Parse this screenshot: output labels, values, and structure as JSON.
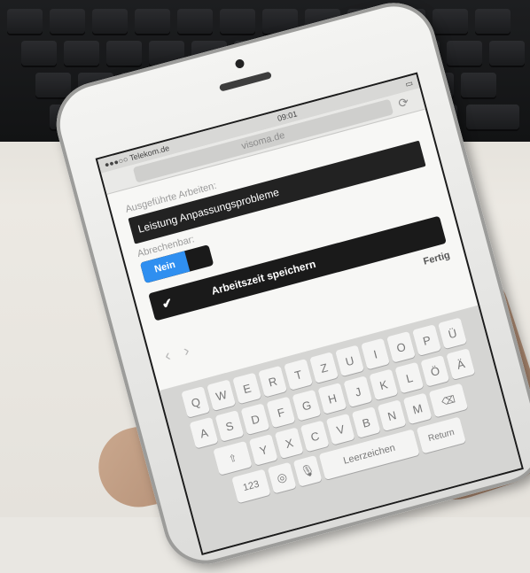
{
  "status": {
    "carrier": "●●●○○ Telekom.de",
    "time": "09:01"
  },
  "browser": {
    "url": "visoma.de",
    "refresh_icon": "refresh-icon"
  },
  "form": {
    "performed_work_label": "Ausgeführte Arbeiten:",
    "performed_work_value": "Leistung Anpassungsprobleme",
    "billable_label": "Abrechenbar:",
    "billable_value": "Nein",
    "save_button_label": "Arbeitszeit speichern",
    "done_label": "Fertig"
  },
  "keyboard": {
    "row1": [
      "Q",
      "W",
      "E",
      "R",
      "T",
      "Z",
      "U",
      "I",
      "O",
      "P",
      "Ü"
    ],
    "row2": [
      "A",
      "S",
      "D",
      "F",
      "G",
      "H",
      "J",
      "K",
      "L",
      "Ö",
      "Ä"
    ],
    "row3": [
      "Y",
      "X",
      "C",
      "V",
      "B",
      "N",
      "M"
    ],
    "numbers_key": "123",
    "space_key": "Leerzeichen",
    "return_key": "Return"
  },
  "colors": {
    "toggle_accent": "#2f8ff0"
  }
}
